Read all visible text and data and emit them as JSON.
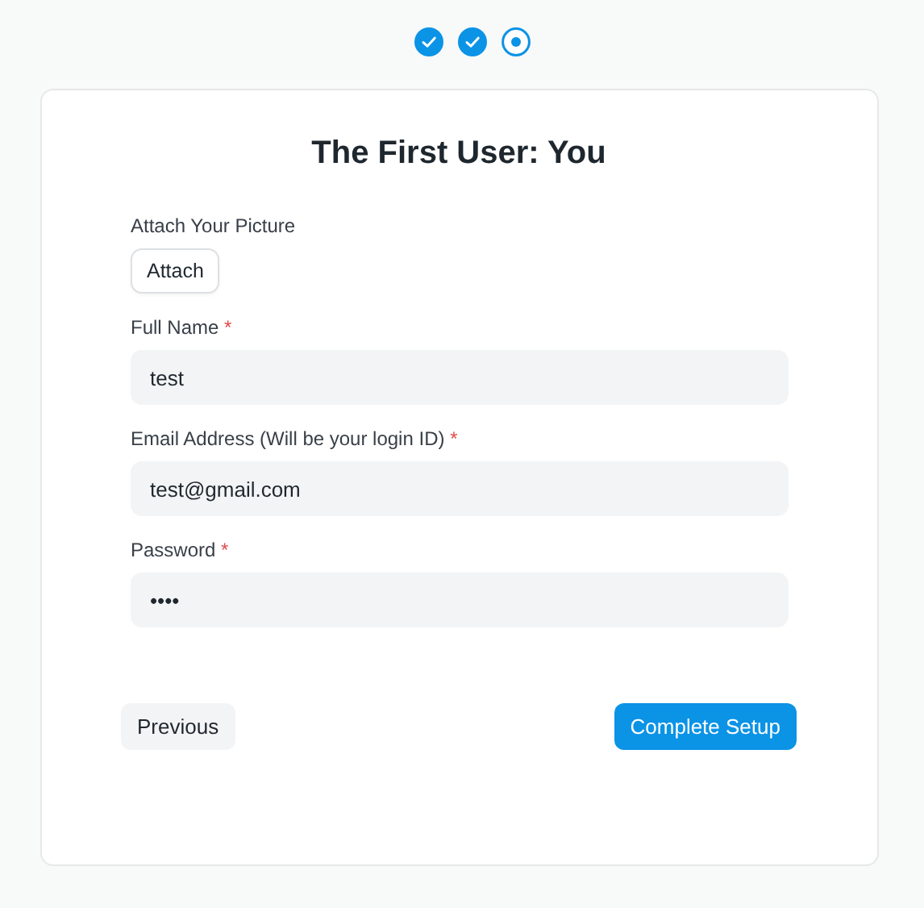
{
  "steps": [
    {
      "done": true,
      "selected": false
    },
    {
      "done": true,
      "selected": false
    },
    {
      "done": false,
      "selected": true
    }
  ],
  "title": "The First User: You",
  "attach": {
    "label": "Attach Your Picture",
    "button": "Attach"
  },
  "fields": [
    {
      "label": "Full Name",
      "required_mark": "*",
      "value": "test"
    },
    {
      "label": "Email Address (Will be your login ID)",
      "required_mark": "*",
      "value": "test@gmail.com"
    },
    {
      "label": "Password",
      "required_mark": "*",
      "value": "••••"
    }
  ],
  "buttons": {
    "previous": "Previous",
    "complete": "Complete Setup"
  }
}
